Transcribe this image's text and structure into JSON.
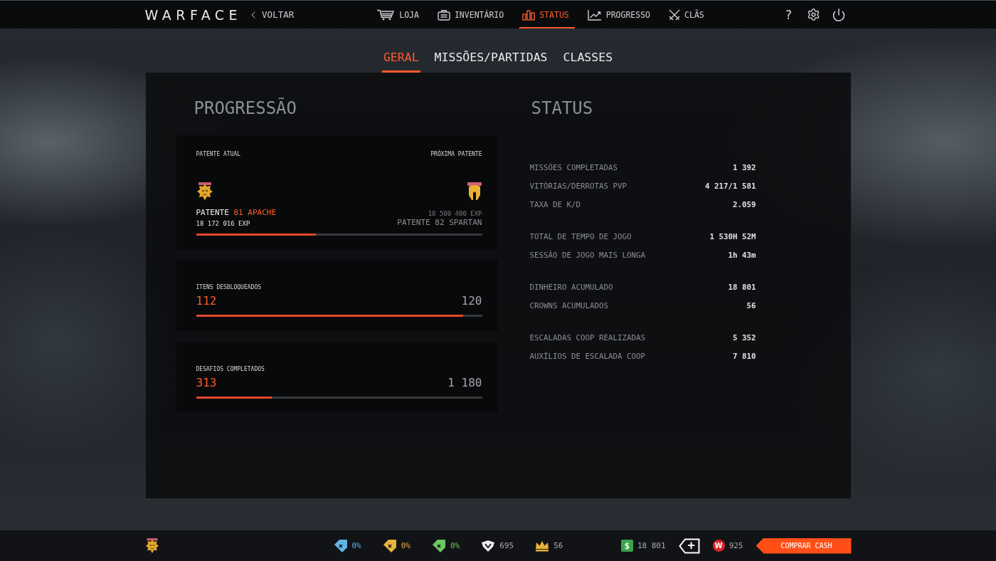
{
  "top_bar": {
    "logo": "WARFACE",
    "back": "VOLTAR",
    "nav": [
      {
        "kind": "cart",
        "label": "LOJA",
        "selected": false
      },
      {
        "kind": "case",
        "label": "INVENTÁRIO",
        "selected": false
      },
      {
        "kind": "bars",
        "label": "STATUS",
        "selected": true
      },
      {
        "kind": "chart",
        "label": "PROGRESSO",
        "selected": false
      },
      {
        "kind": "swords",
        "label": "CLÃS",
        "selected": false
      }
    ],
    "help": "?"
  },
  "tabs": [
    {
      "label": "GERAL",
      "selected": true
    },
    {
      "label": "MISSÕES/PARTIDAS",
      "selected": false
    },
    {
      "label": "CLASSES",
      "selected": false
    }
  ],
  "progression": {
    "title": "PROGRESSÃO",
    "rank_card": {
      "current_heading": "PATENTE ATUAL",
      "next_heading": "PRÓXIMA PATENTE",
      "current_prefix": "PATENTE",
      "current_name": "81 APACHE",
      "current_exp": "18 172 016 EXP",
      "next_exp": "18 500 400 EXP",
      "next_name": "PATENTE 82 SPARTAN",
      "level": 0.42
    },
    "counters": [
      {
        "label": "ITENS DESBLOQUEADOS",
        "value": "112",
        "total": "120",
        "level": 0.933
      },
      {
        "label": "DESAFIOS COMPLETADOS",
        "value": "313",
        "total": "1 180",
        "level": 0.265
      }
    ]
  },
  "status": {
    "title": "STATUS",
    "groups": [
      {
        "rows": [
          {
            "label": "MISSÕES COMPLETADAS",
            "value": "1 392"
          },
          {
            "label": "VITÓRIAS/DERROTAS PVP",
            "value": "4 217/1 581"
          },
          {
            "label": "TAXA DE K/D",
            "value": "2.059"
          }
        ]
      },
      {
        "rows": [
          {
            "label": "TOTAL DE TEMPO DE JOGO",
            "value": "1 530H 52M"
          },
          {
            "label": "SESSÃO DE JOGO MAIS LONGA",
            "value": "1h 43m"
          }
        ]
      },
      {
        "rows": [
          {
            "label": "DINHEIRO ACUMULADO",
            "value": "18 801"
          },
          {
            "label": "CROWNS ACUMULADOS",
            "value": "56"
          }
        ]
      },
      {
        "rows": [
          {
            "label": "ESCALADAS COOP REALIZADAS",
            "value": "5 352"
          },
          {
            "label": "AUXÍLIOS DE ESCALADA COOP",
            "value": "7 810"
          }
        ]
      }
    ]
  },
  "bottom_bar": {
    "boosters": [
      {
        "color": "#62b3e4",
        "value": "0%"
      },
      {
        "color": "#e9b43c",
        "value": "0%"
      },
      {
        "color": "#6cc860",
        "value": "0%"
      }
    ],
    "resources": [
      {
        "kind": "emblem",
        "value": "695"
      },
      {
        "kind": "crown",
        "value": "56"
      }
    ],
    "money": {
      "symbol": "$",
      "value": "18 801"
    },
    "add": "+",
    "coin": {
      "symbol": "W",
      "value": "925"
    },
    "buy_button": "COMPRAR CASH"
  }
}
